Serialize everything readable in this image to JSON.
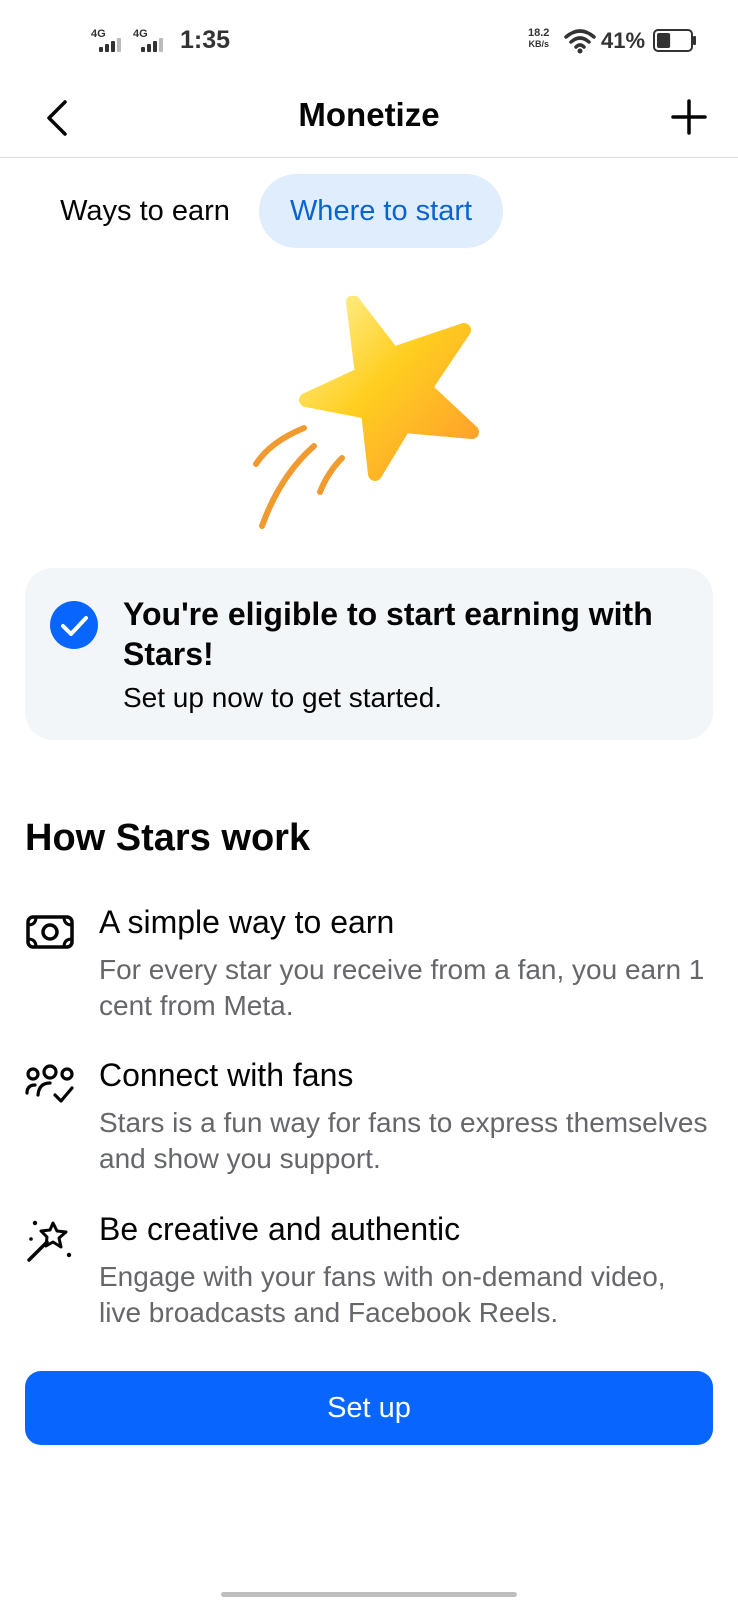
{
  "status_bar": {
    "network1": "4G",
    "network2": "4G",
    "time": "1:35",
    "speed_value": "18.2",
    "speed_unit": "KB/s",
    "battery_percent": "41%",
    "battery_level": 0.41
  },
  "header": {
    "title": "Monetize",
    "back_icon": "chevron-left-icon",
    "add_icon": "plus-icon"
  },
  "tabs": [
    {
      "label": "Ways to earn",
      "selected": false
    },
    {
      "label": "Where to start",
      "selected": true
    }
  ],
  "illustration": {
    "icon": "shooting-star-illustration"
  },
  "eligibility": {
    "title": "You're eligible to start earning with Stars!",
    "subtitle": "Set up now to get started.",
    "icon": "check-circle-icon"
  },
  "how_stars_work": {
    "title": "How Stars work",
    "items": [
      {
        "icon": "money-icon",
        "title": "A simple way to earn",
        "description": "For every star you receive from a fan, you earn 1 cent from Meta."
      },
      {
        "icon": "people-check-icon",
        "title": "Connect with fans",
        "description": "Stars is a fun way for fans to express themselves and show you support."
      },
      {
        "icon": "magic-wand-icon",
        "title": "Be creative and authentic",
        "description": "Engage with your fans with on-demand video, live broadcasts and Facebook Reels."
      }
    ]
  },
  "setup_button": {
    "label": "Set up"
  },
  "colors": {
    "accent": "#0866ff",
    "tab_selected_bg": "#e0edfc",
    "tab_selected_text": "#0a64d0",
    "card_bg": "#f3f6f9",
    "secondary_text": "#65676b"
  }
}
